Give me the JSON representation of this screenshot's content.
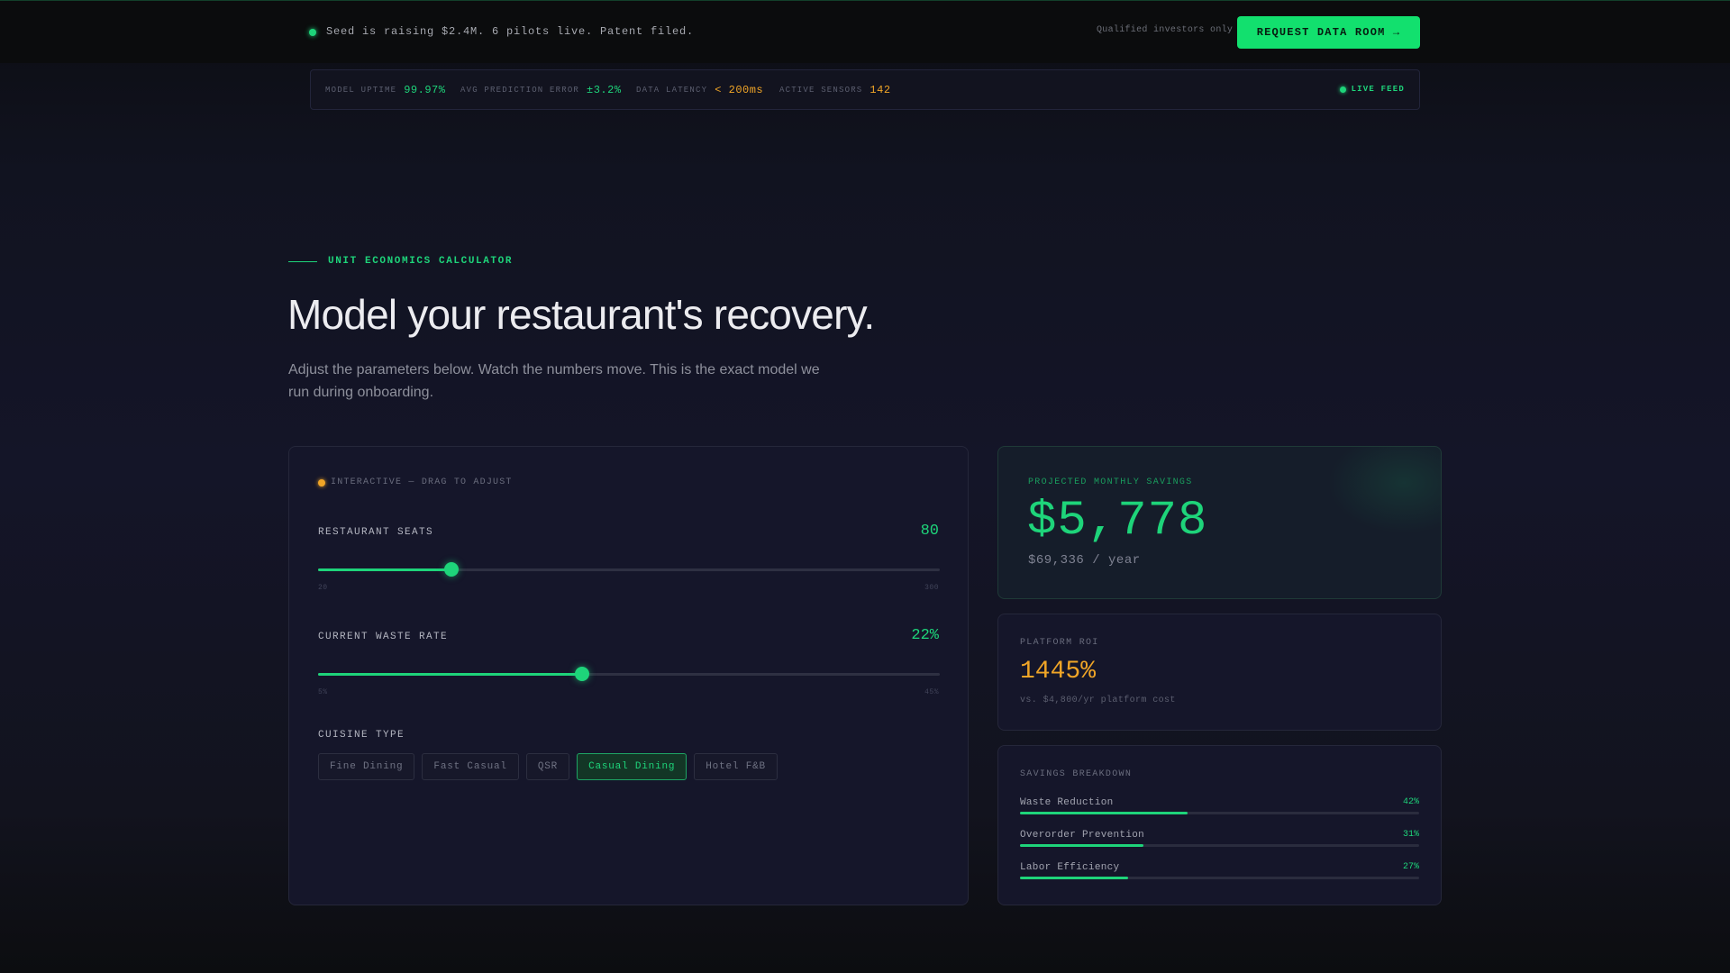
{
  "banner": {
    "message": "Seed is raising $2.4M. 6 pilots live. Patent filed.",
    "qualifier": "Qualified investors only",
    "cta_label": "REQUEST DATA ROOM →"
  },
  "metrics": {
    "items": [
      {
        "label": "MODEL UPTIME",
        "value": "99.97%",
        "color": "#1ed47a"
      },
      {
        "label": "AVG PREDICTION ERROR",
        "value": "±3.2%",
        "color": "#1ed47a"
      },
      {
        "label": "DATA LATENCY",
        "value": "< 200ms",
        "color": "#f0a527"
      },
      {
        "label": "ACTIVE SENSORS",
        "value": "142",
        "color": "#f0a527"
      }
    ],
    "live_label": "LIVE FEED"
  },
  "section": {
    "eyebrow": "UNIT ECONOMICS CALCULATOR",
    "headline": "Model your restaurant's recovery.",
    "subtext": "Adjust the parameters below. Watch the numbers move. This is the exact model we run during onboarding."
  },
  "calculator": {
    "badge": "INTERACTIVE — DRAG TO ADJUST",
    "seats": {
      "label": "RESTAURANT SEATS",
      "value_text": "80",
      "value": 80,
      "min": 20,
      "max": 300,
      "min_label": "20",
      "max_label": "300"
    },
    "waste": {
      "label": "CURRENT WASTE RATE",
      "value_text": "22%",
      "value": 22,
      "min": 5,
      "max": 45,
      "min_label": "5%",
      "max_label": "45%"
    },
    "cuisine": {
      "label": "CUISINE TYPE",
      "options": [
        "Fine Dining",
        "Fast Casual",
        "QSR",
        "Casual Dining",
        "Hotel F&B"
      ],
      "selected": "Casual Dining"
    }
  },
  "results": {
    "savings": {
      "label": "PROJECTED MONTHLY SAVINGS",
      "value": "$5,778",
      "per_year": "$69,336 / year"
    },
    "roi": {
      "label": "PLATFORM ROI",
      "value": "1445%",
      "note": "vs. $4,800/yr platform cost"
    },
    "breakdown": {
      "label": "SAVINGS BREAKDOWN",
      "items": [
        {
          "name": "Waste Reduction",
          "pct_text": "42%",
          "pct": 42
        },
        {
          "name": "Overorder Prevention",
          "pct_text": "31%",
          "pct": 31
        },
        {
          "name": "Labor Efficiency",
          "pct_text": "27%",
          "pct": 27
        }
      ]
    }
  },
  "colors": {
    "accent": "#1ed47a",
    "warning": "#f0a527"
  }
}
